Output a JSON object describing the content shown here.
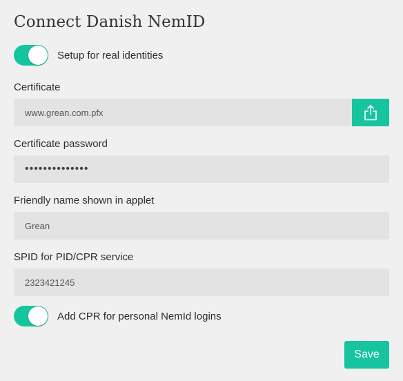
{
  "page": {
    "title": "Connect Danish NemID"
  },
  "real_identities": {
    "label": "Setup for real identities",
    "enabled": true
  },
  "certificate": {
    "label": "Certificate",
    "value": "www.grean.com.pfx",
    "upload_icon": "upload-icon"
  },
  "certificate_password": {
    "label": "Certificate password",
    "value": "••••••••••••••"
  },
  "friendly_name": {
    "label": "Friendly name shown in applet",
    "value": "Grean"
  },
  "spid": {
    "label": "SPID for PID/CPR service",
    "value": "2323421245"
  },
  "add_cpr": {
    "label": "Add CPR for personal NemId logins",
    "enabled": true
  },
  "actions": {
    "save_label": "Save"
  },
  "colors": {
    "accent": "#16c5a0",
    "background": "#f0f0f1",
    "field_background": "#e3e3e4"
  }
}
